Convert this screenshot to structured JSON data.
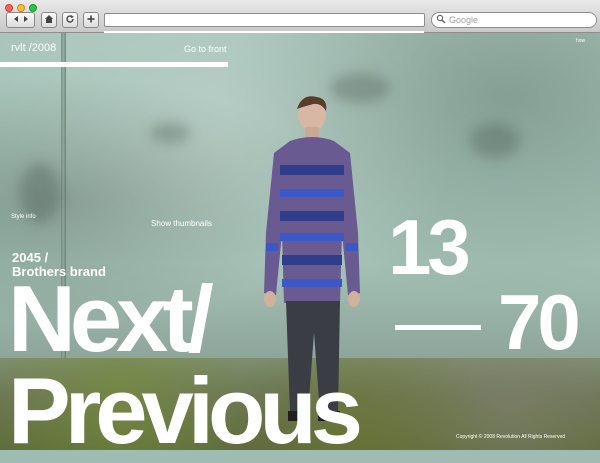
{
  "browser": {
    "search_placeholder": "Google",
    "icons": {
      "back": "back-arrow-icon",
      "forward": "forward-arrow-icon",
      "home": "home-icon",
      "reload": "reload-icon",
      "add": "plus-icon",
      "search": "magnifier-icon"
    },
    "colors": {
      "close": "#ff5f57",
      "minimize": "#ffbd2e",
      "zoom": "#28c840"
    }
  },
  "site": {
    "brand": "rvlt /2008",
    "go_to_front": "Go to front",
    "top_right": "how",
    "style_info": "Style info",
    "show_thumbnails": "Show thumbnails",
    "item_code": "2045 /",
    "item_name": "Brothers brand",
    "next_label": "Next/",
    "previous_label": "Previous",
    "current_index": "13",
    "total_count": "70",
    "copyright": "Copyright © 2008 Revolution     All Rights Reserved"
  }
}
